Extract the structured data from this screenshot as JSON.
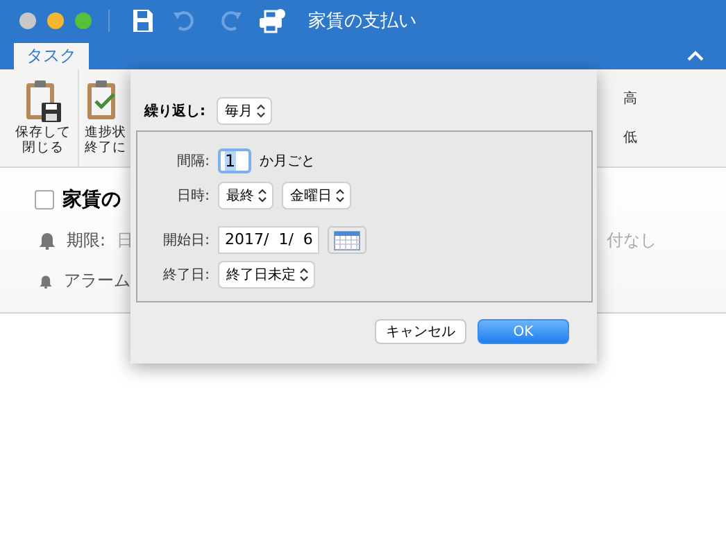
{
  "window": {
    "title": "家賃の支払い"
  },
  "toolbar": [
    {
      "kind": "save",
      "disabled": false
    },
    {
      "kind": "undo",
      "disabled": true
    },
    {
      "kind": "redo",
      "disabled": true
    },
    {
      "kind": "print",
      "disabled": false
    }
  ],
  "tabs": [
    {
      "label": "タスク",
      "selected": true
    }
  ],
  "ribbon": {
    "buttons": [
      {
        "kind": "save-close",
        "lines": [
          "保存して",
          "閉じる"
        ]
      },
      {
        "kind": "progress",
        "lines": [
          "進捗状",
          "終了に"
        ]
      }
    ],
    "priority": [
      "高",
      "低"
    ]
  },
  "task": {
    "title": "家賃の",
    "completed": false,
    "due_label": "期限:",
    "due_value": "日",
    "due_value_right": "付なし",
    "alarm_label": "アラーム"
  },
  "dialog": {
    "repeat_label": "繰り返し:",
    "repeat_value": "毎月",
    "interval_label": "間隔:",
    "interval_value": "1",
    "interval_unit": "か月ごと",
    "day_label": "日時:",
    "day_ordinal": "最終",
    "day_weekday": "金曜日",
    "start_label": "開始日:",
    "start_value": "2017/  1/  6",
    "end_label": "終了日:",
    "end_value": "終了日未定",
    "buttons": [
      {
        "label": "キャンセル",
        "default": false
      },
      {
        "label": "OK",
        "default": true
      }
    ]
  }
}
